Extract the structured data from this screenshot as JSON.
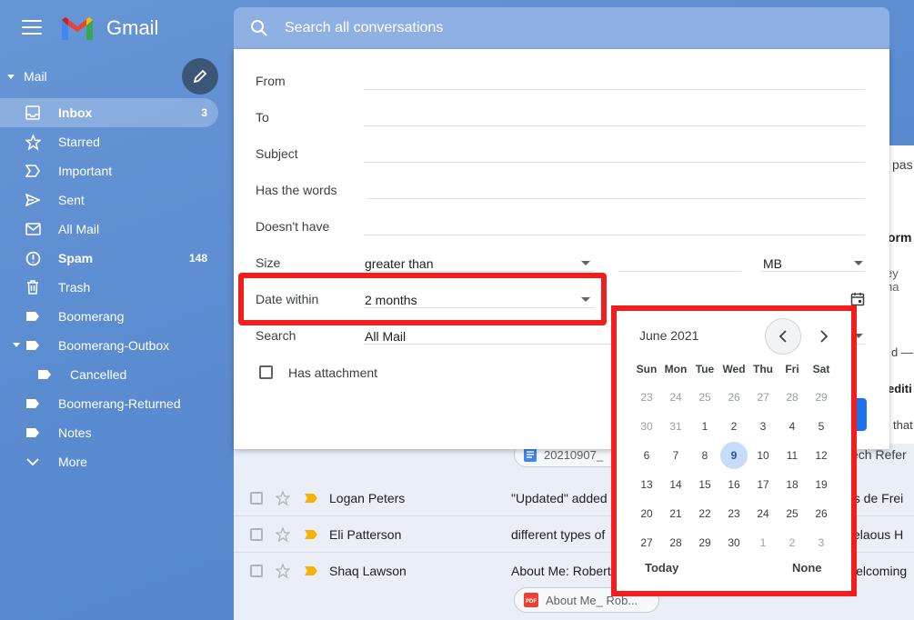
{
  "brand": {
    "name": "Gmail"
  },
  "sidebar": {
    "header": "Mail",
    "items": [
      {
        "label": "Inbox",
        "count": "3",
        "icon": "inbox-icon"
      },
      {
        "label": "Starred",
        "count": "",
        "icon": "star-icon"
      },
      {
        "label": "Important",
        "count": "",
        "icon": "important-icon"
      },
      {
        "label": "Sent",
        "count": "",
        "icon": "send-icon"
      },
      {
        "label": "All Mail",
        "count": "",
        "icon": "mail-icon"
      },
      {
        "label": "Spam",
        "count": "148",
        "icon": "spam-icon"
      },
      {
        "label": "Trash",
        "count": "",
        "icon": "trash-icon"
      },
      {
        "label": "Boomerang",
        "count": "",
        "icon": "label-icon"
      },
      {
        "label": "Boomerang-Outbox",
        "count": "",
        "icon": "label-icon"
      },
      {
        "label": "Cancelled",
        "count": "",
        "icon": "label-icon"
      },
      {
        "label": "Boomerang-Returned",
        "count": "",
        "icon": "label-icon"
      },
      {
        "label": "Notes",
        "count": "",
        "icon": "label-icon"
      },
      {
        "label": "More",
        "count": "",
        "icon": "chevron-down-icon"
      }
    ]
  },
  "search": {
    "placeholder": "Search all conversations"
  },
  "form": {
    "from_label": "From",
    "to_label": "To",
    "subject_label": "Subject",
    "has_words_label": "Has the words",
    "doesnt_have_label": "Doesn't have",
    "size_label": "Size",
    "size_operator": "greater than",
    "size_unit": "MB",
    "date_label": "Date within",
    "date_value": "2 months",
    "search_label": "Search",
    "search_value": "All Mail",
    "attachment_label": "Has attachment"
  },
  "calendar": {
    "month": "June 2021",
    "weekdays": [
      "Sun",
      "Mon",
      "Tue",
      "Wed",
      "Thu",
      "Fri",
      "Sat"
    ],
    "weeks": [
      [
        "23",
        "24",
        "25",
        "26",
        "27",
        "28",
        "29"
      ],
      [
        "30",
        "31",
        "1",
        "2",
        "3",
        "4",
        "5"
      ],
      [
        "6",
        "7",
        "8",
        "9",
        "10",
        "11",
        "12"
      ],
      [
        "13",
        "14",
        "15",
        "16",
        "17",
        "18",
        "19"
      ],
      [
        "20",
        "21",
        "22",
        "23",
        "24",
        "25",
        "26"
      ],
      [
        "27",
        "28",
        "29",
        "30",
        "1",
        "2",
        "3"
      ]
    ],
    "selected": "9",
    "today_label": "Today",
    "none_label": "None"
  },
  "emails": [
    {
      "sender": "Logan Peters",
      "subject": "\"Updated\" added",
      "right": "os de Frei"
    },
    {
      "sender": "Eli Patterson",
      "subject": "different types of",
      "right": "zelaous H"
    },
    {
      "sender": "Shaq Lawson",
      "subject": "About Me: Robert",
      "right": "welcoming"
    }
  ],
  "attachments": {
    "doc_name": "20210907_",
    "doc_right": "Tech Refer",
    "pdf_name": "About Me_ Rob..."
  },
  "right_pane": {
    "t1": "pas",
    "t2": "orm",
    "t3": "ey ha",
    "t4": "d —",
    "t5": "editi",
    "t6": "that"
  },
  "colors": {
    "accent": "#1a73e8",
    "highlight": "#f21d1d",
    "sidebar_bg": "#5f8fd3"
  }
}
